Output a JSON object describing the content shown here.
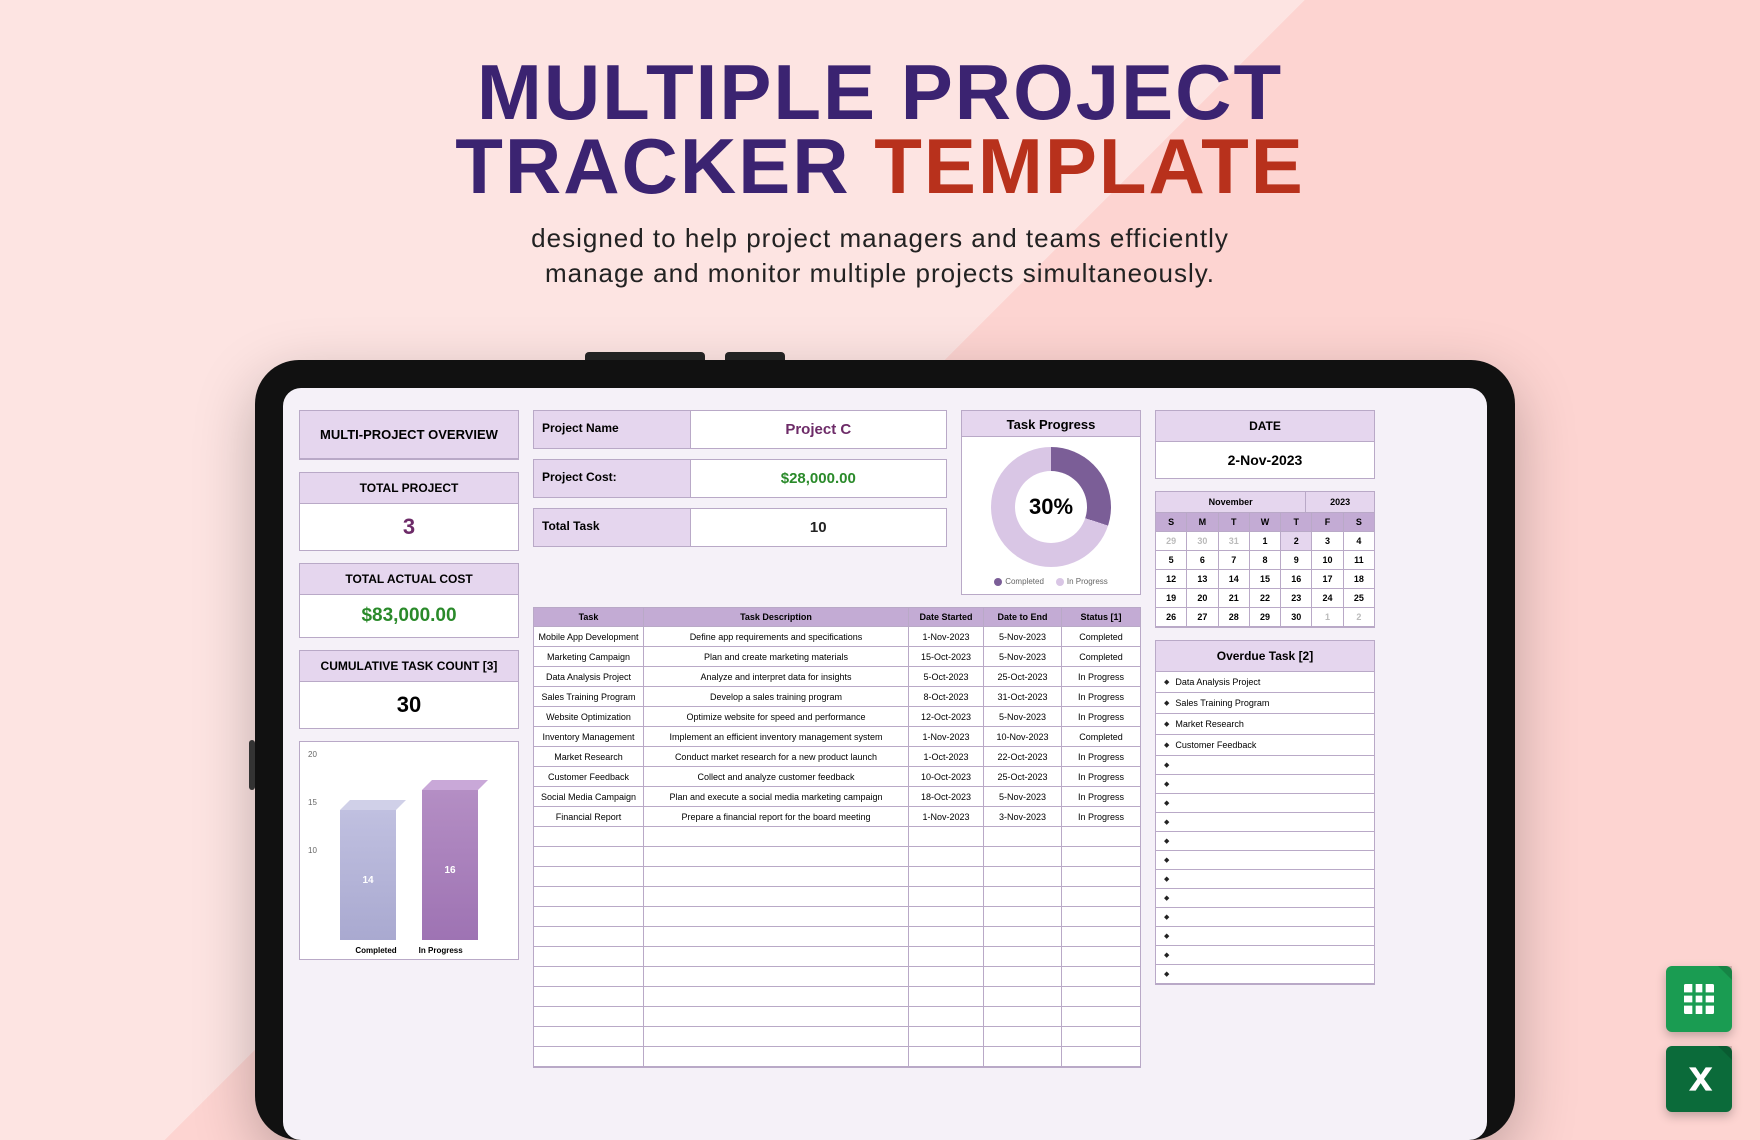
{
  "title": {
    "line1a": "MULTIPLE PROJECT",
    "line1b": "TRACKER",
    "line1c": "TEMPLATE"
  },
  "subtitle": "designed to help project managers and teams efficiently\nmanage and monitor multiple projects simultaneously.",
  "left": {
    "overview_title": "MULTI-PROJECT OVERVIEW",
    "total_project_label": "TOTAL PROJECT",
    "total_project_value": "3",
    "total_cost_label": "TOTAL ACTUAL COST",
    "total_cost_value": "$83,000.00",
    "task_count_label": "CUMULATIVE TASK COUNT [3]",
    "task_count_value": "30"
  },
  "mid": {
    "project_name_label": "Project Name",
    "project_name_value": "Project C",
    "project_cost_label": "Project Cost:",
    "project_cost_value": "$28,000.00",
    "total_task_label": "Total Task",
    "total_task_value": "10",
    "progress_title": "Task Progress",
    "progress_value": "30%",
    "legend_completed": "Completed",
    "legend_inprogress": "In Progress",
    "table_headers": [
      "Task",
      "Task Description",
      "Date Started",
      "Date to End",
      "Status [1]"
    ],
    "rows": [
      [
        "Mobile App Development",
        "Define app requirements and specifications",
        "1-Nov-2023",
        "5-Nov-2023",
        "Completed"
      ],
      [
        "Marketing Campaign",
        "Plan and create marketing materials",
        "15-Oct-2023",
        "5-Nov-2023",
        "Completed"
      ],
      [
        "Data Analysis Project",
        "Analyze and interpret data for insights",
        "5-Oct-2023",
        "25-Oct-2023",
        "In Progress"
      ],
      [
        "Sales Training Program",
        "Develop a sales training program",
        "8-Oct-2023",
        "31-Oct-2023",
        "In Progress"
      ],
      [
        "Website Optimization",
        "Optimize website for speed and performance",
        "12-Oct-2023",
        "5-Nov-2023",
        "In Progress"
      ],
      [
        "Inventory Management",
        "Implement an efficient inventory management system",
        "1-Nov-2023",
        "10-Nov-2023",
        "Completed"
      ],
      [
        "Market Research",
        "Conduct market research for a new product launch",
        "1-Oct-2023",
        "22-Oct-2023",
        "In Progress"
      ],
      [
        "Customer Feedback",
        "Collect and analyze customer feedback",
        "10-Oct-2023",
        "25-Oct-2023",
        "In Progress"
      ],
      [
        "Social Media Campaign",
        "Plan and execute a social media marketing campaign",
        "18-Oct-2023",
        "5-Nov-2023",
        "In Progress"
      ],
      [
        "Financial Report",
        "Prepare a financial report for the board meeting",
        "1-Nov-2023",
        "3-Nov-2023",
        "In Progress"
      ]
    ]
  },
  "right": {
    "date_label": "DATE",
    "date_value": "2-Nov-2023",
    "cal_month": "November",
    "cal_year": "2023",
    "dow": [
      "S",
      "M",
      "T",
      "W",
      "T",
      "F",
      "S"
    ],
    "weeks": [
      [
        "29",
        "30",
        "31",
        "1",
        "2",
        "3",
        "4"
      ],
      [
        "5",
        "6",
        "7",
        "8",
        "9",
        "10",
        "11"
      ],
      [
        "12",
        "13",
        "14",
        "15",
        "16",
        "17",
        "18"
      ],
      [
        "19",
        "20",
        "21",
        "22",
        "23",
        "24",
        "25"
      ],
      [
        "26",
        "27",
        "28",
        "29",
        "30",
        "1",
        "2"
      ]
    ],
    "overdue_title": "Overdue Task [2]",
    "overdue": [
      "Data Analysis Project",
      "Sales Training Program",
      "Market Research",
      "Customer Feedback"
    ]
  },
  "chart_data": {
    "type": "bar",
    "title": "",
    "categories": [
      "Completed",
      "In Progress"
    ],
    "values": [
      14,
      16
    ],
    "ylim": [
      0,
      20
    ],
    "ylabel": "",
    "xlabel": ""
  },
  "icons": {
    "sheets": "google-sheets-icon",
    "excel": "excel-icon"
  }
}
